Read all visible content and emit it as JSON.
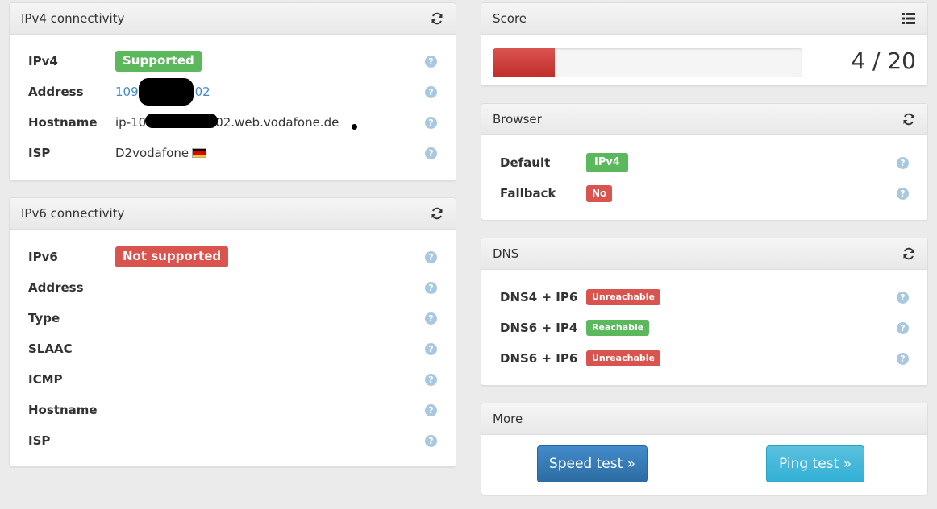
{
  "ipv4_panel": {
    "title": "IPv4 connectivity",
    "rows": [
      {
        "label": "IPv4",
        "badge": "Supported"
      },
      {
        "label": "Address",
        "value_start": "109",
        "value_end": "02"
      },
      {
        "label": "Hostname",
        "value_start": "ip-10",
        "value_end": "02.web.vodafone.de"
      },
      {
        "label": "ISP",
        "value": "D2vodafone"
      }
    ]
  },
  "ipv6_panel": {
    "title": "IPv6 connectivity",
    "rows": [
      {
        "label": "IPv6",
        "badge": "Not supported"
      },
      {
        "label": "Address"
      },
      {
        "label": "Type"
      },
      {
        "label": "SLAAC"
      },
      {
        "label": "ICMP"
      },
      {
        "label": "Hostname"
      },
      {
        "label": "ISP"
      }
    ]
  },
  "score_panel": {
    "title": "Score",
    "score": 4,
    "max": 20,
    "score_text": "4 / 20"
  },
  "browser_panel": {
    "title": "Browser",
    "rows": [
      {
        "label": "Default",
        "badge": "IPv4"
      },
      {
        "label": "Fallback",
        "badge": "No"
      }
    ]
  },
  "dns_panel": {
    "title": "DNS",
    "rows": [
      {
        "label": "DNS4 + IP6",
        "badge": "Unreachable"
      },
      {
        "label": "DNS6 + IP4",
        "badge": "Reachable"
      },
      {
        "label": "DNS6 + IP6",
        "badge": "Unreachable"
      }
    ]
  },
  "more_panel": {
    "title": "More",
    "speed_test": "Speed test »",
    "ping_test": "Ping test »"
  },
  "help_glyph": "?",
  "icons": {
    "refresh": "refresh-icon",
    "list": "list-icon",
    "help": "help-icon",
    "flag": "flag-germany-icon"
  },
  "colors": {
    "success": "#5cb85c",
    "danger": "#d9534f",
    "primary": "#428bca",
    "info": "#5bc0de",
    "help": "#a9c8e0"
  }
}
